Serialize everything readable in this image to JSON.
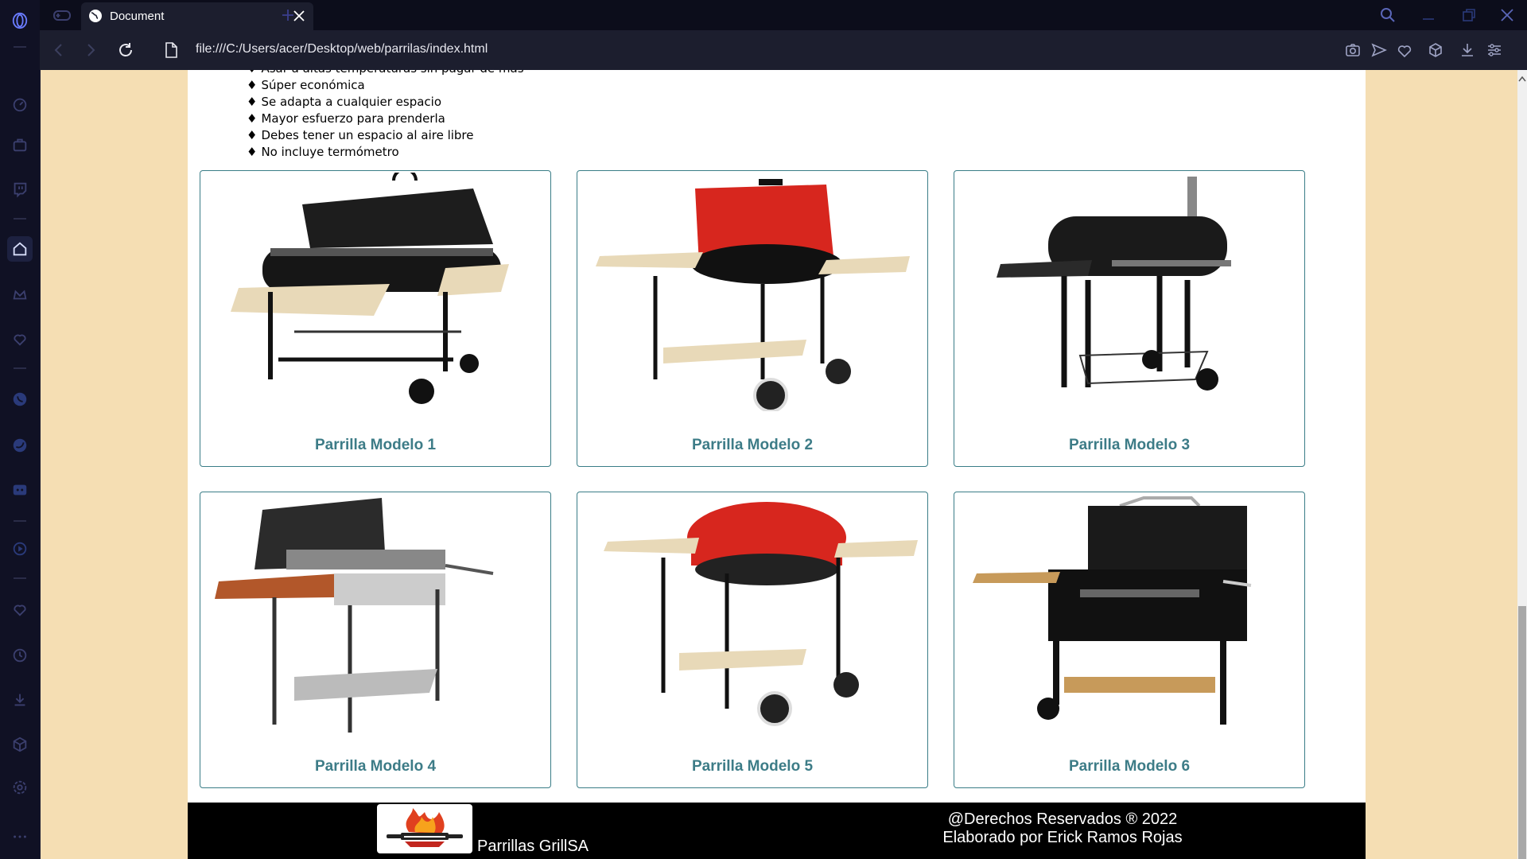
{
  "browser": {
    "tab_title": "Document",
    "url": "file:///C:/Users/acer/Desktop/web/parrilas/index.html"
  },
  "features": [
    "Asar a altas temperaturas sin pagar de más",
    "Súper económica",
    "Se adapta a cualquier espacio",
    "Mayor esfuerzo para prenderla",
    "Debes tener un espacio al aire libre",
    "No incluye termómetro"
  ],
  "products": [
    {
      "title": "Parrilla Modelo 1",
      "lid_color": "#1a1a1a",
      "shelf_color": "#e8d9b8"
    },
    {
      "title": "Parrilla Modelo 2",
      "lid_color": "#d7261e",
      "shelf_color": "#e8d9b8"
    },
    {
      "title": "Parrilla Modelo 3",
      "lid_color": "#1a1a1a",
      "shelf_color": "#2a2a2a"
    },
    {
      "title": "Parrilla Modelo 4",
      "lid_color": "#2b2b2b",
      "shelf_color": "#b2572a"
    },
    {
      "title": "Parrilla Modelo 5",
      "lid_color": "#d7261e",
      "shelf_color": "#e8d9b8"
    },
    {
      "title": "Parrilla Modelo 6",
      "lid_color": "#1a1a1a",
      "shelf_color": "#c79a5a"
    }
  ],
  "footer": {
    "brand": "Parrillas GrillSA",
    "copyright": "@Derechos Reservados ® 2022",
    "author": "Elaborado por Erick Ramos Rojas"
  },
  "colors": {
    "page_background": "#f5deb3",
    "accent": "#3d7c87",
    "card_border": "#3a7d87",
    "footer_background": "#000000"
  },
  "icons": {
    "sidebar": [
      "opera-logo-icon",
      "speed-dial-icon",
      "bag-icon",
      "twitch-icon",
      "home-icon",
      "crown-icon",
      "heart-icon",
      "whatsapp-icon",
      "twitter-icon",
      "discord-icon",
      "player-icon",
      "heart-outline-icon",
      "history-icon",
      "download-icon",
      "box-icon",
      "settings-icon",
      "more-icon"
    ],
    "addressbar": [
      "camera-icon",
      "send-icon",
      "heart-icon",
      "cube-icon",
      "download-icon",
      "menu-icon"
    ]
  }
}
